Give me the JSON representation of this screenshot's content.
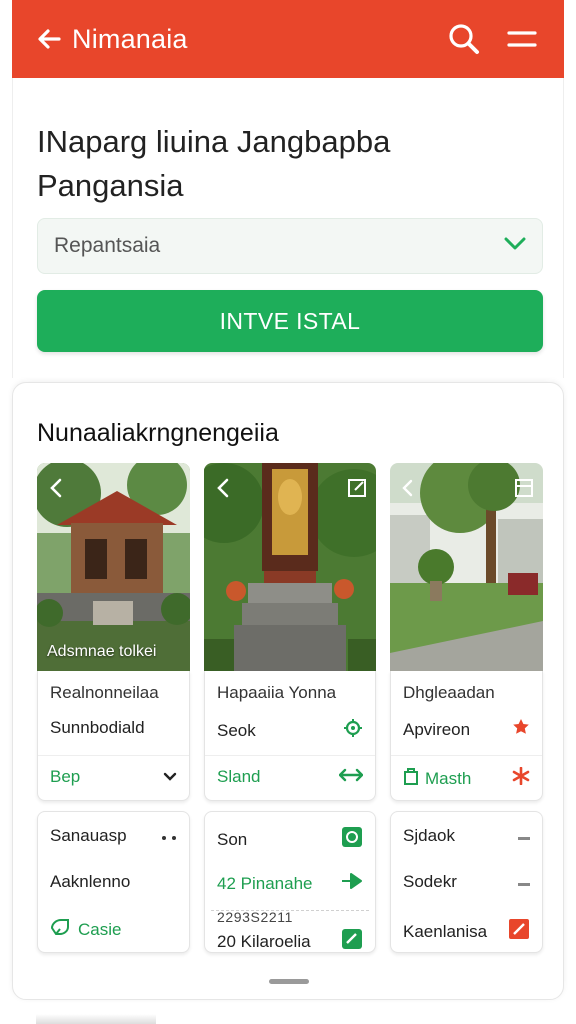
{
  "app_bar": {
    "title": "Nimanaia",
    "back_icon": "arrow-left-icon",
    "search_icon": "search-icon",
    "menu_icon": "menu-icon",
    "color": "#e8462b"
  },
  "form": {
    "heading_line1": "INaparg liuina Jangbapba",
    "heading_line2": "Pangansia",
    "select_value": "Repantsaia",
    "primary_button": "INTVE ISTAL",
    "primary_color": "#1eae5a"
  },
  "section": {
    "title": "Nunaaliakrngnengeiia",
    "columns": [
      {
        "caption": "Adsmnae tolkei",
        "row1": "Realnonneilaa",
        "row2": "Sunnbodiald",
        "row3": "Bep",
        "card2": {
          "row1": "Sanauasp",
          "row2": "Aaknlenno",
          "row3": "Casie"
        }
      },
      {
        "row1": "Hapaaiia Yonna",
        "row2": "Seok",
        "row3": "Sland",
        "card2": {
          "row1": "Son",
          "row2": "42  Pinanahe",
          "row3a": "2293S2211",
          "row3b": "20 Kilaroelia"
        }
      },
      {
        "row1": "Dhgleaadan",
        "row2": "Apvireon",
        "row3": "Masth",
        "card2": {
          "row1": "Sjdaok",
          "row2": "Sodekr",
          "row3": "Kaenlanisa"
        }
      }
    ]
  },
  "colors": {
    "accent_green": "#1e9e50",
    "accent_red": "#e8462b"
  }
}
